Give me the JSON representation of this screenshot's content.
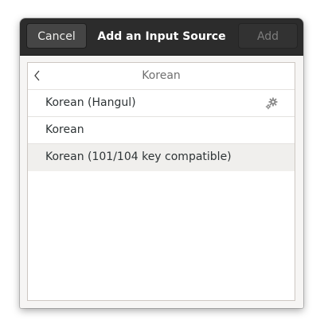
{
  "header": {
    "title": "Add an Input Source",
    "cancel_label": "Cancel",
    "add_label": "Add"
  },
  "list": {
    "category": "Korean",
    "items": [
      {
        "label": "Korean (Hangul)",
        "has_settings": true,
        "icon": "gear-icon"
      },
      {
        "label": "Korean"
      },
      {
        "label": "Korean (101/104 key compatible)",
        "selected": true
      }
    ]
  },
  "colors": {
    "headerbar_bg": "#2c2c2c",
    "dialog_bg": "#f6f5f4",
    "selected_row_bg": "#f0efed"
  }
}
